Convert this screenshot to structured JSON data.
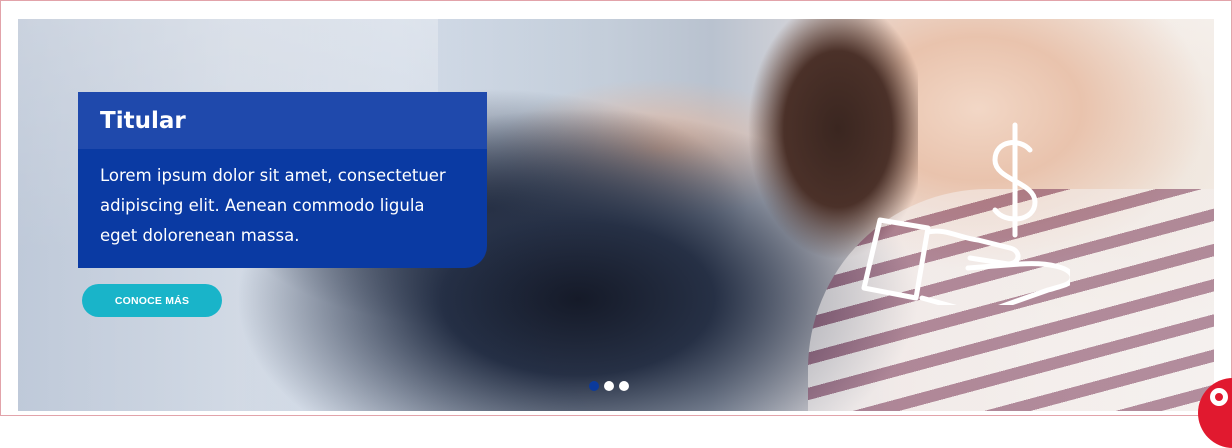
{
  "banner": {
    "title": "Titular",
    "body": "Lorem ipsum dolor sit amet, consectetuer adipiscing elit. Aenean commodo ligula eget dolorenean massa.",
    "cta_label": "CONOCE MÁS"
  },
  "carousel": {
    "slide_count": 3,
    "active_index": 0
  },
  "icons": {
    "illustration": "hand-holding-dollar-icon",
    "floating_button": "chat-icon"
  },
  "colors": {
    "card_background": "#0a3aa3",
    "card_title_bar": "#1f49ac",
    "cta_background": "#19b4c9",
    "active_dot": "#0b3a9c",
    "floating_button": "#e1192f",
    "frame_border": "#e2a3aa"
  }
}
